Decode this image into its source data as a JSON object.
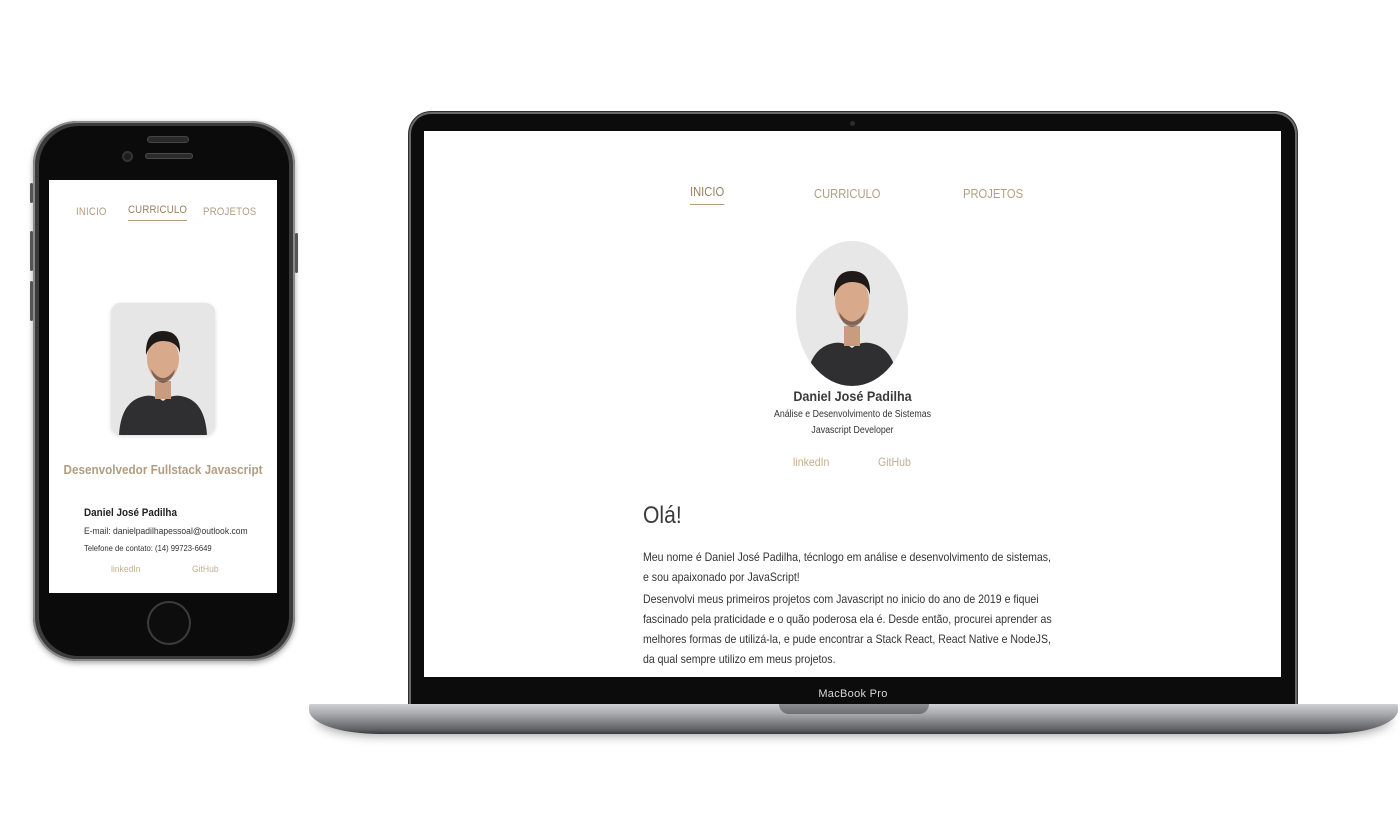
{
  "phone": {
    "nav": {
      "inicio": "INICIO",
      "curriculo": "CURRICULO",
      "projetos": "PROJETOS",
      "active": "CURRICULO"
    },
    "role": "Desenvolvedor Fullstack Javascript",
    "name": "Daniel José Padilha",
    "email": "E-mail: danielpadilhapessoal@outlook.com",
    "phone_line": "Telefone de contato: (14) 99723-6649",
    "links": {
      "linkedin": "linkedIn",
      "github": "GitHub"
    }
  },
  "laptop": {
    "model_label": "MacBook Pro",
    "nav": {
      "inicio": "INICIO",
      "curriculo": "CURRICULO",
      "projetos": "PROJETOS",
      "active": "INICIO"
    },
    "name": "Daniel José Padilha",
    "subtitle_1": "Análise e Desenvolvimento de Sistemas",
    "subtitle_2": "Javascript Developer",
    "links": {
      "linkedin": "linkedIn",
      "github": "GitHub"
    },
    "greeting": "Olá!",
    "paragraph_1": "Meu nome é Daniel José Padilha, técnlogo em análise e desenvolvimento de sistemas, e sou apaixonado por JavaScript!",
    "paragraph_2": "Desenvolvi meus primeiros projetos com Javascript no inicio do ano de 2019 e fiquei fascinado pela praticidade e o quão poderosa ela é. Desde então, procurei aprender as melhores formas de utilizá-la, e pude encontrar a Stack React, React Native e NodeJS, da qual sempre utilizo em meus projetos."
  },
  "colors": {
    "accent": "#b29d83",
    "text": "#333333",
    "device_dark": "#0c0c0c"
  }
}
